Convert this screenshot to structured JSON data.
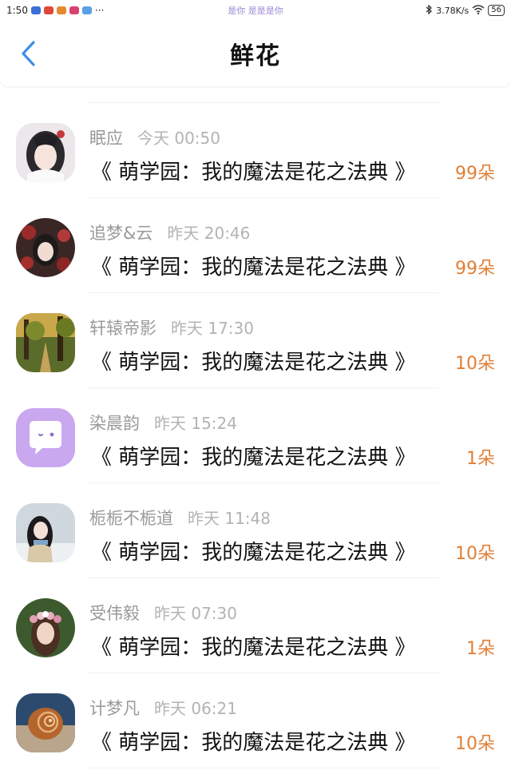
{
  "status_bar": {
    "time": "1:50",
    "ellipsis": "···",
    "center_text": "是你 是是是你",
    "network_speed": "3.78K/s",
    "battery": "56"
  },
  "header": {
    "title": "鲜花"
  },
  "rows": [
    {
      "nickname": "眠应",
      "time": "今天 00:50",
      "book": "《 萌学园：我的魔法是花之法典 》",
      "count": "99朵",
      "avatar_icon": "avatar-girl-white-icon"
    },
    {
      "nickname": "追梦&云",
      "time": "昨天 20:46",
      "book": "《 萌学园：我的魔法是花之法典 》",
      "count": "99朵",
      "avatar_icon": "avatar-red-flowers-icon"
    },
    {
      "nickname": "轩辕帝影",
      "time": "昨天 17:30",
      "book": "《 萌学园：我的魔法是花之法典 》",
      "count": "10朵",
      "avatar_icon": "avatar-forest-icon"
    },
    {
      "nickname": "染晨韵",
      "time": "昨天 15:24",
      "book": "《 萌学园：我的魔法是花之法典 》",
      "count": "1朵",
      "avatar_icon": "avatar-chat-bubble-icon"
    },
    {
      "nickname": "栀栀不栀道",
      "time": "昨天 11:48",
      "book": "《 萌学园：我的魔法是花之法典 》",
      "count": "10朵",
      "avatar_icon": "avatar-girl-snow-icon"
    },
    {
      "nickname": "受伟毅",
      "time": "昨天 07:30",
      "book": "《 萌学园：我的魔法是花之法典 》",
      "count": "1朵",
      "avatar_icon": "avatar-flower-crown-icon"
    },
    {
      "nickname": "计梦凡",
      "time": "昨天 06:21",
      "book": "《 萌学园：我的魔法是花之法典 》",
      "count": "10朵",
      "avatar_icon": "avatar-shell-icon"
    }
  ],
  "colors": {
    "accent_blue": "#3d8ee8",
    "count_orange": "#e07f36",
    "muted_text": "#9a9a9a"
  }
}
